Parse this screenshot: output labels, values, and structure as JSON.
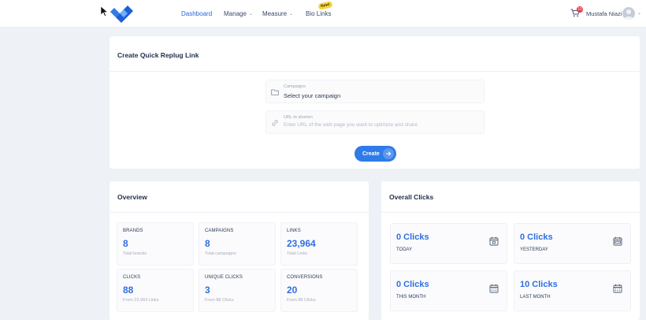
{
  "header": {
    "nav": [
      {
        "label": "Dashboard"
      },
      {
        "label": "Manage"
      },
      {
        "label": "Measure"
      },
      {
        "label": "Bio Links"
      }
    ],
    "new_badge": "New!",
    "cart_count": "10",
    "user_name": "Mustafa Niazi",
    "colors": {
      "accent": "#2a66d9",
      "badge": "#e53950"
    }
  },
  "quick_link": {
    "title": "Create Quick Replug Link",
    "campaign": {
      "label": "Campaigns",
      "value": "Select your campaign",
      "icon": "folder-icon"
    },
    "url": {
      "label": "URL to shorten",
      "placeholder": "Enter URL of the web page you want to optimize and share",
      "icon": "link-icon"
    },
    "create_label": "Create"
  },
  "overview": {
    "title": "Overview",
    "stats": [
      {
        "label": "BRANDS",
        "value": "8",
        "sub": "Total brands"
      },
      {
        "label": "CAMPAIGNS",
        "value": "8",
        "sub": "Total campaigns"
      },
      {
        "label": "LINKS",
        "value": "23,964",
        "sub": "Total Links"
      },
      {
        "label": "CLICKS",
        "value": "88",
        "sub": "From 23,964 Links"
      },
      {
        "label": "UNIQUE CLICKS",
        "value": "3",
        "sub": "From 88 Clicks"
      },
      {
        "label": "CONVERSIONS",
        "value": "20",
        "sub": "From 88 Clicks"
      }
    ]
  },
  "overall_clicks": {
    "title": "Overall Clicks",
    "items": [
      {
        "value": "0 Clicks",
        "label": "TODAY",
        "icon": "calendar-day-icon"
      },
      {
        "value": "0 Clicks",
        "label": "YESTERDAY",
        "icon": "calendar-week-icon"
      },
      {
        "value": "0 Clicks",
        "label": "THIS MONTH",
        "icon": "calendar-month-icon"
      },
      {
        "value": "10 Clicks",
        "label": "LAST MONTH",
        "icon": "calendar-month-icon"
      }
    ]
  }
}
